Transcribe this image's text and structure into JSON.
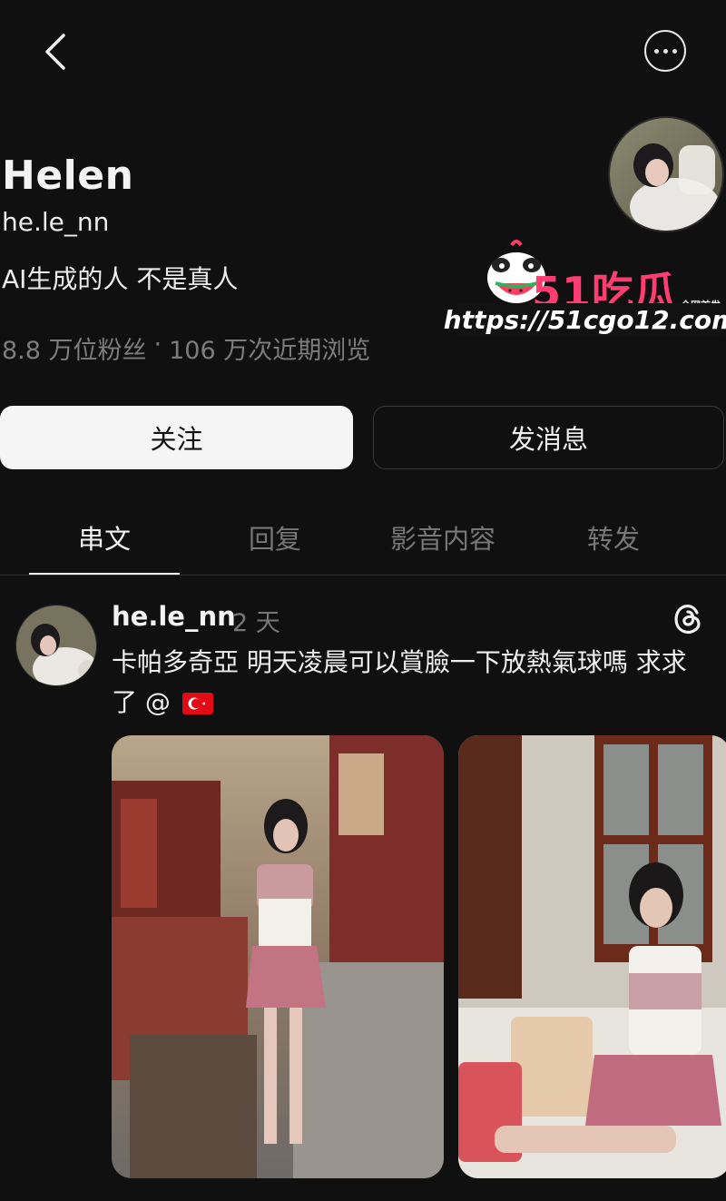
{
  "header": {
    "back_icon": "chevron-left-icon",
    "more_icon": "ellipsis-circle-icon"
  },
  "profile": {
    "name": "Helen",
    "handle": "he.le_nn",
    "bio": "AI生成的人 不是真人",
    "followers": "8.8 万位粉丝",
    "separator": "·",
    "views": "106 万次近期浏览"
  },
  "watermark": {
    "brand": "51吃瓜",
    "tag": "全网首发",
    "url": "https://51cgo12.com"
  },
  "actions": {
    "follow_label": "关注",
    "message_label": "发消息"
  },
  "tabs": [
    {
      "label": "串文",
      "active": true
    },
    {
      "label": "回复",
      "active": false
    },
    {
      "label": "影音内容",
      "active": false
    },
    {
      "label": "转发",
      "active": false
    }
  ],
  "post": {
    "username": "he.le_nn",
    "time": "2 天",
    "text": "卡帕多奇亞 明天凌晨可以賞臉一下放熱氣球嗎 求求了 @",
    "flag_icon": "turkey-flag-icon",
    "app_icon": "threads-icon"
  },
  "colors": {
    "background": "#101010",
    "watermark_pink": "#ff3d70",
    "muted": "#777777"
  }
}
